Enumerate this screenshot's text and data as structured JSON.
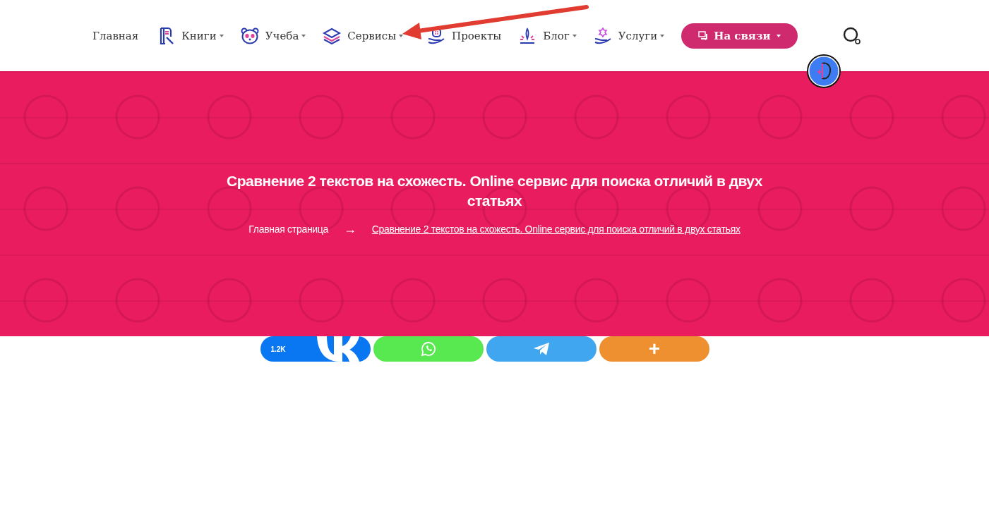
{
  "nav": {
    "items": [
      {
        "label": "Главная",
        "has_menu": false
      },
      {
        "label": "Книги",
        "has_menu": true
      },
      {
        "label": "Учеба",
        "has_menu": true
      },
      {
        "label": "Сервисы",
        "has_menu": true
      },
      {
        "label": "Проекты",
        "has_menu": false
      },
      {
        "label": "Блог",
        "has_menu": true
      },
      {
        "label": "Услуги",
        "has_menu": true
      }
    ],
    "cta": {
      "label": "На связи",
      "has_menu": true
    }
  },
  "hero": {
    "title": "Сравнение 2 текстов на схожесть. Online сервис для поиска отличий в двух статьях",
    "breadcrumbs": [
      {
        "label": "Главная страница",
        "current": false
      },
      {
        "label": "Сравнение 2 текстов на схожесть. Online сервис для поиска отличий в двух статьях",
        "current": true
      }
    ],
    "separator": "→"
  },
  "share": [
    {
      "kind": "vk",
      "count": "1.2K"
    },
    {
      "kind": "whatsapp"
    },
    {
      "kind": "telegram"
    },
    {
      "kind": "more",
      "label": "+"
    }
  ]
}
